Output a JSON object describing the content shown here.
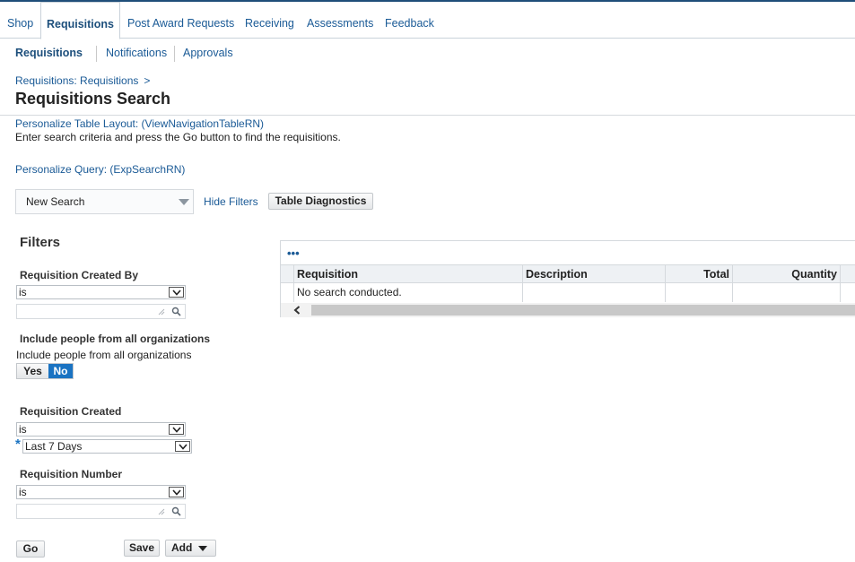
{
  "main_tabs": [
    "Shop",
    "Requisitions",
    "Post Award Requests",
    "Receiving",
    "Assessments",
    "Feedback"
  ],
  "sub_tabs": [
    "Requisitions",
    "Notifications",
    "Approvals"
  ],
  "breadcrumb": {
    "link": "Requisitions: Requisitions",
    "separator": ">"
  },
  "page_title": "Requisitions Search",
  "personalize_table": "Personalize Table Layout: (ViewNavigationTableRN)",
  "instruction": "Enter search criteria and press the Go button to find the requisitions.",
  "personalize_query": "Personalize Query: (ExpSearchRN)",
  "search_toolbar": {
    "saved_search_value": "New Search",
    "hide_filters": "Hide Filters",
    "table_diagnostics": "Table Diagnostics"
  },
  "filters": {
    "heading": "Filters",
    "created_by": {
      "label": "Requisition Created By",
      "operator": "is",
      "value": ""
    },
    "include_people": {
      "label": "Include people from all organizations",
      "sublabel": "Include people from all organizations",
      "yes": "Yes",
      "no": "No",
      "selected": "No"
    },
    "created": {
      "label": "Requisition Created",
      "operator": "is",
      "value": "Last 7 Days",
      "required_mark": "*"
    },
    "number": {
      "label": "Requisition Number",
      "operator": "is",
      "value": ""
    },
    "buttons": {
      "go": "Go",
      "save": "Save",
      "add": "Add"
    }
  },
  "results_table": {
    "more_actions": "•••",
    "columns": [
      "Requisition",
      "Description",
      "Total",
      "Quantity"
    ],
    "empty_message": "No search conducted."
  },
  "colors": {
    "link": "#1a5a96",
    "toggle_selected": "#1a73c2",
    "header_bg": "#eef1f4"
  }
}
